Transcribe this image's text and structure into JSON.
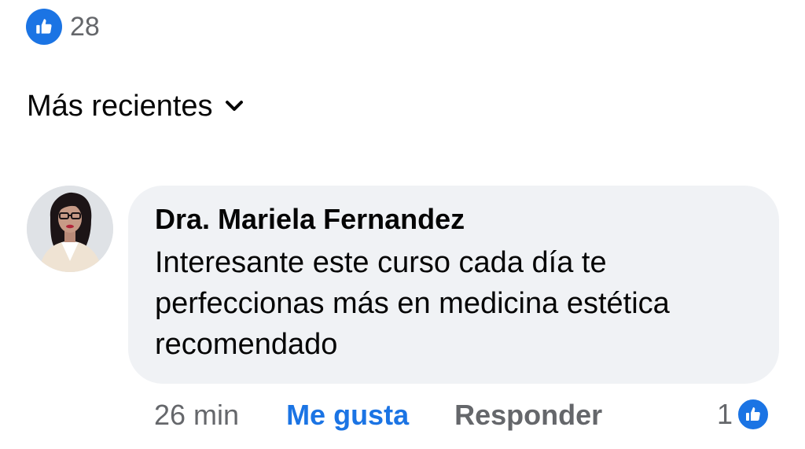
{
  "reactions": {
    "count": "28",
    "icon": "thumbs-up-icon",
    "color": "#1b74e4"
  },
  "sort": {
    "label": "Más recientes",
    "icon": "chevron-down-icon"
  },
  "comment": {
    "author": "Dra. Mariela Fernandez",
    "text": "Interesante este curso cada día te perfeccionas más en medicina estética  recomendado",
    "time": "26 min",
    "like_label": "Me gusta",
    "reply_label": "Responder",
    "reaction_count": "1",
    "reaction_icon": "thumbs-up-icon"
  },
  "colors": {
    "accent": "#1b74e4",
    "muted": "#65676b",
    "bubble": "#f0f2f5"
  }
}
